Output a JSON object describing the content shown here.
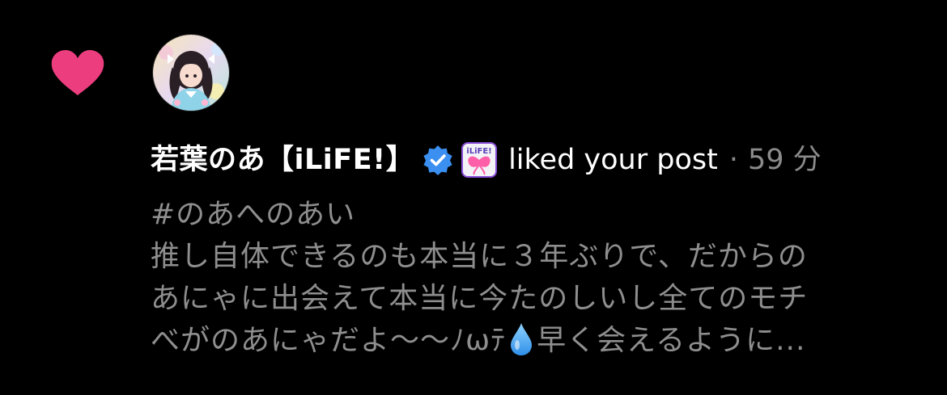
{
  "notification": {
    "type_icon": "heart-icon",
    "type_color": "#ec3d7f",
    "avatar": "profile-photo",
    "user_name": "若葉のあ【iLiFE!】",
    "verified_icon": "verified-badge-icon",
    "verified_color": "#3a8ff0",
    "badge_icon": "ilife-logo-badge",
    "badge_text": "iLiFE!",
    "action": "liked your post",
    "separator": "·",
    "time": "59 分",
    "post_lines": [
      "#のあへのあい",
      "推し自体できるのも本当に３年ぶりで、だからの",
      "あにゃに出会えて本当に今たのしいし全てのモチ",
      "べがのあにゃだよ〜〜ﾉωﾃ"
    ],
    "post_emoji": "droplet-emoji",
    "post_tail": "早く会えるように..."
  },
  "colors": {
    "background": "#000000",
    "primary_text": "#ffffff",
    "secondary_text": "#8e8e8e"
  }
}
